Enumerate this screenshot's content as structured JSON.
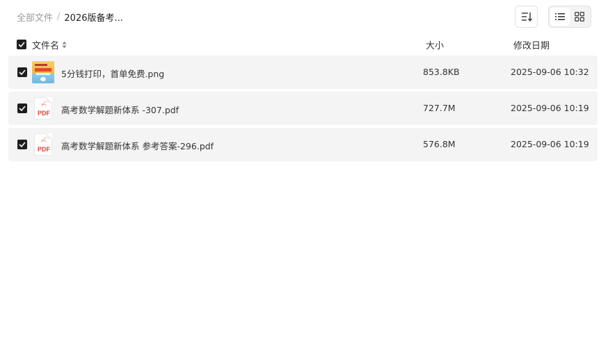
{
  "breadcrumb": {
    "root": "全部文件",
    "separator": "/",
    "current": "2026版备考..."
  },
  "toolbar": {
    "sort_icon": "sort-lines-icon",
    "view_list_icon": "list-view-icon",
    "view_grid_icon": "grid-view-icon",
    "active_view": "list"
  },
  "header": {
    "name": "文件名",
    "size": "大小",
    "date": "修改日期",
    "all_checked": true
  },
  "files": [
    {
      "name": "5分钱打印，首单免费.png",
      "size": "853.8KB",
      "date": "2025-09-06 10:32",
      "type": "image",
      "checked": true
    },
    {
      "name": "高考数学解题新体系 -307.pdf",
      "size": "727.7M",
      "date": "2025-09-06 10:19",
      "type": "pdf",
      "checked": true
    },
    {
      "name": "高考数学解题新体系 参考答案-296.pdf",
      "size": "576.8M",
      "date": "2025-09-06 10:19",
      "type": "pdf",
      "checked": true
    }
  ],
  "pdf_badge": "PDF",
  "colors": {
    "row_bg": "#f4f4f4",
    "checkbox": "#1e1e1e",
    "pdf_red": "#e0423a"
  }
}
